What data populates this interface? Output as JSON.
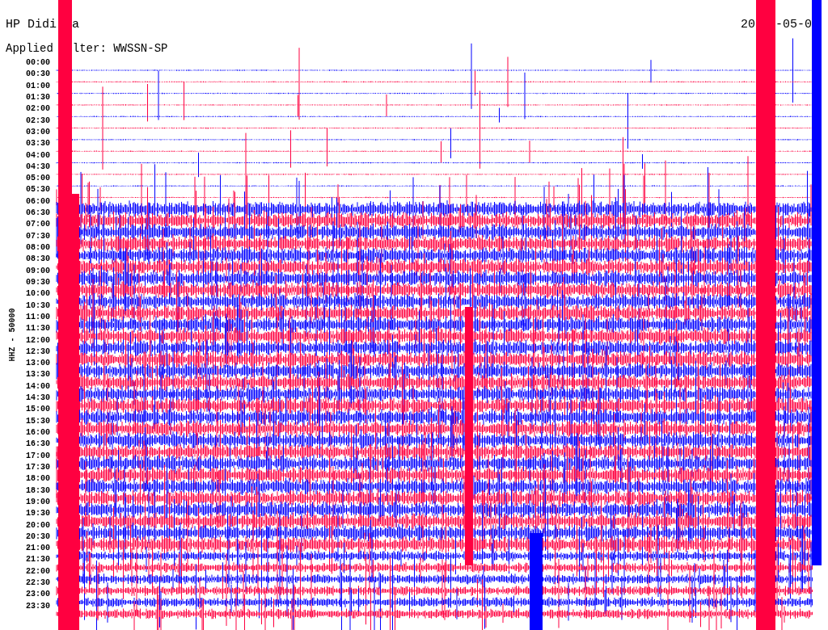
{
  "header": {
    "station_parts": [
      "HP Didi",
      "a"
    ],
    "date_parts": [
      "20",
      "-05-0"
    ],
    "filter_parts": [
      "Applied",
      "lter: WWSSN-SP"
    ]
  },
  "channel_label": "HHZ - 50000",
  "time_labels": [
    "00:00",
    "00:30",
    "01:00",
    "01:30",
    "02:00",
    "02:30",
    "03:00",
    "03:30",
    "04:00",
    "04:30",
    "05:00",
    "05:30",
    "06:00",
    "06:30",
    "07:00",
    "07:30",
    "08:00",
    "08:30",
    "09:00",
    "09:30",
    "10:00",
    "10:30",
    "11:00",
    "11:30",
    "12:00",
    "12:30",
    "13:00",
    "13:30",
    "14:00",
    "14:30",
    "15:00",
    "15:30",
    "16:00",
    "16:30",
    "17:00",
    "17:30",
    "18:00",
    "18:30",
    "19:00",
    "19:30",
    "20:00",
    "20:30",
    "21:00",
    "21:30",
    "22:00",
    "22:30",
    "23:00",
    "23:30"
  ]
}
